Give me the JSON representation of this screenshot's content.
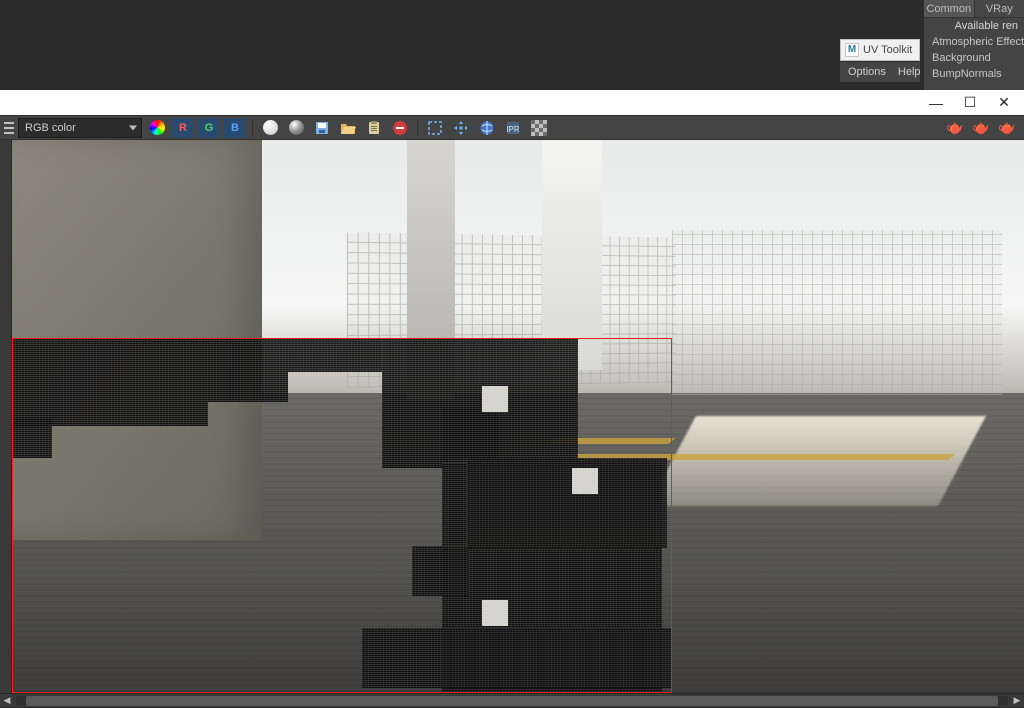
{
  "render_settings_panel": {
    "tabs": [
      "Common",
      "VRay"
    ],
    "available_label": "Available ren",
    "items": [
      "Atmospheric Effects",
      "Background",
      "BumpNormals"
    ]
  },
  "uv_toolkit": {
    "label": "UV Toolkit",
    "logo_letter": "M"
  },
  "menu_strip": {
    "options": "Options",
    "help": "Help"
  },
  "window_controls": {
    "minimize": "—",
    "maximize": "☐",
    "close": "✕"
  },
  "rv_toolbar": {
    "channel_combo": "RGB color",
    "rgb_r": "R",
    "rgb_g": "G",
    "rgb_b": "B"
  },
  "icons": {
    "swirl": "rgb-swirl-icon",
    "sphere_white": "sphere-white-icon",
    "sphere_grey": "sphere-grey-icon",
    "save": "save-icon",
    "open": "open-icon",
    "clipboard": "clipboard-icon",
    "stop": "stop-icon",
    "region": "region-icon",
    "move_region": "move-region-icon",
    "world": "world-icon",
    "ipr": "ipr-icon",
    "checker": "checker-icon",
    "teapot1": "teapot-green-icon",
    "teapot2": "teapot-grey-icon",
    "teapot3": "teapot-blue-icon"
  },
  "scroll": {
    "left_arrow": "◀",
    "right_arrow": "▶"
  }
}
